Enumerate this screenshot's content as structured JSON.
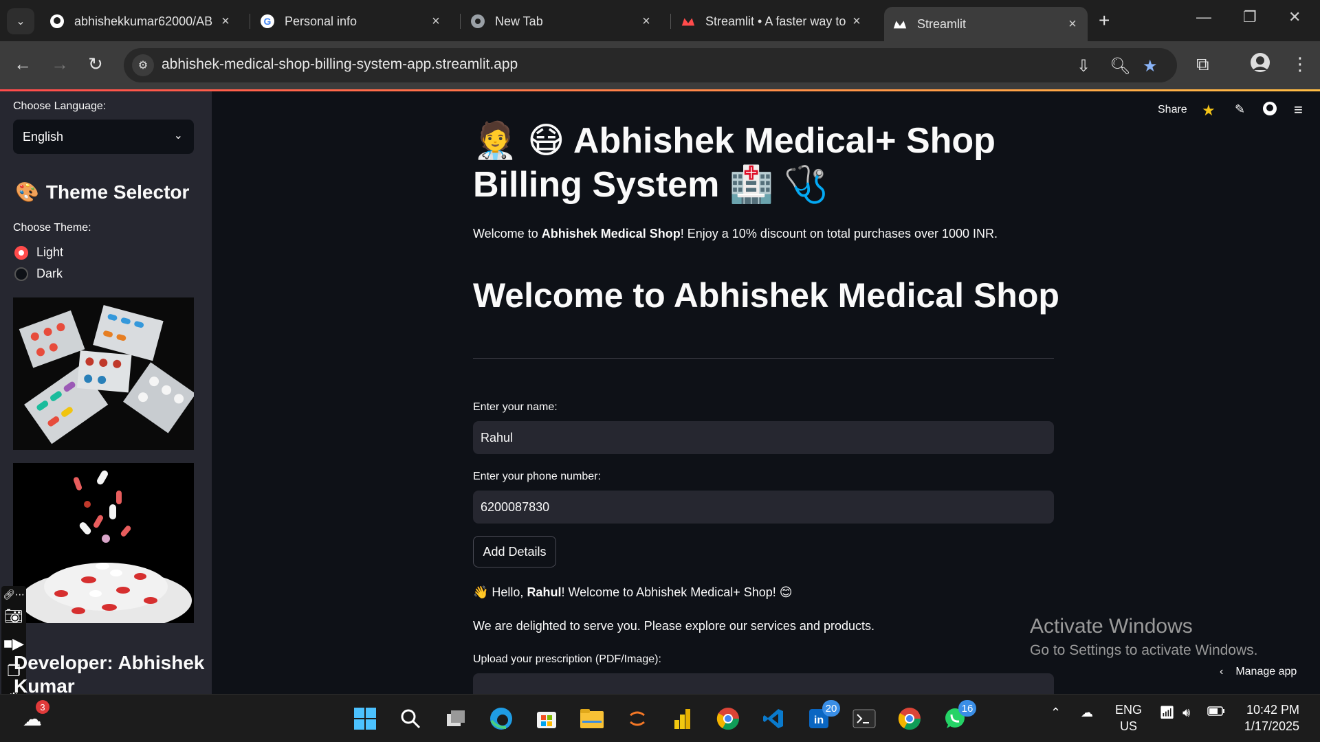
{
  "browser": {
    "tabs": [
      {
        "title": "abhishekkumar62000/AB",
        "icon": "github-icon",
        "active": false
      },
      {
        "title": "Personal info",
        "icon": "google-icon",
        "active": false
      },
      {
        "title": "New Tab",
        "icon": "chrome-icon",
        "active": false
      },
      {
        "title": "Streamlit • A faster way to",
        "icon": "streamlit-icon",
        "active": false
      },
      {
        "title": "Streamlit",
        "icon": "streamlit-icon",
        "active": true
      }
    ],
    "url": "abhishek-medical-shop-billing-system-app.streamlit.app"
  },
  "sidebar": {
    "language_label": "Choose Language:",
    "language_value": "English",
    "theme_heading": "Theme Selector",
    "theme_label": "Choose Theme:",
    "theme_options": [
      "Light",
      "Dark"
    ],
    "theme_selected": "Light",
    "developer": "Developer: Abhishek Kumar"
  },
  "header": {
    "share_label": "Share"
  },
  "main": {
    "title": "🧑‍⚕️ 😷 Abhishek Medical+ Shop Billing System 🏥 🩺",
    "intro_prefix": "Welcome to ",
    "intro_bold": "Abhishek Medical Shop",
    "intro_suffix": "! Enjoy a 10% discount on total purchases over 1000 INR.",
    "welcome_heading": "Welcome to Abhishek Medical Shop",
    "name_label": "Enter your name:",
    "name_value": "Rahul",
    "phone_label": "Enter your phone number:",
    "phone_value": "6200087830",
    "add_button": "Add Details",
    "hello_prefix": "👋 Hello, ",
    "hello_name": "Rahul",
    "hello_suffix": "! Welcome to Abhishek Medical+ Shop! 😊",
    "delighted": "We are delighted to serve you. Please explore our services and products.",
    "upload_label": "Upload your prescription (PDF/Image):"
  },
  "overlay": {
    "activate_title": "Activate Windows",
    "activate_sub": "Go to Settings to activate Windows.",
    "manage_app": "Manage app"
  },
  "taskbar": {
    "weather_badge": "3",
    "linkedin_badge": "20",
    "whatsapp_badge": "16",
    "lang_line1": "ENG",
    "lang_line2": "US",
    "time": "10:42 PM",
    "date": "1/17/2025"
  },
  "colors": {
    "accent": "#ff4b4b",
    "app_bg": "#0e1117",
    "sidebar_bg": "#262730"
  }
}
